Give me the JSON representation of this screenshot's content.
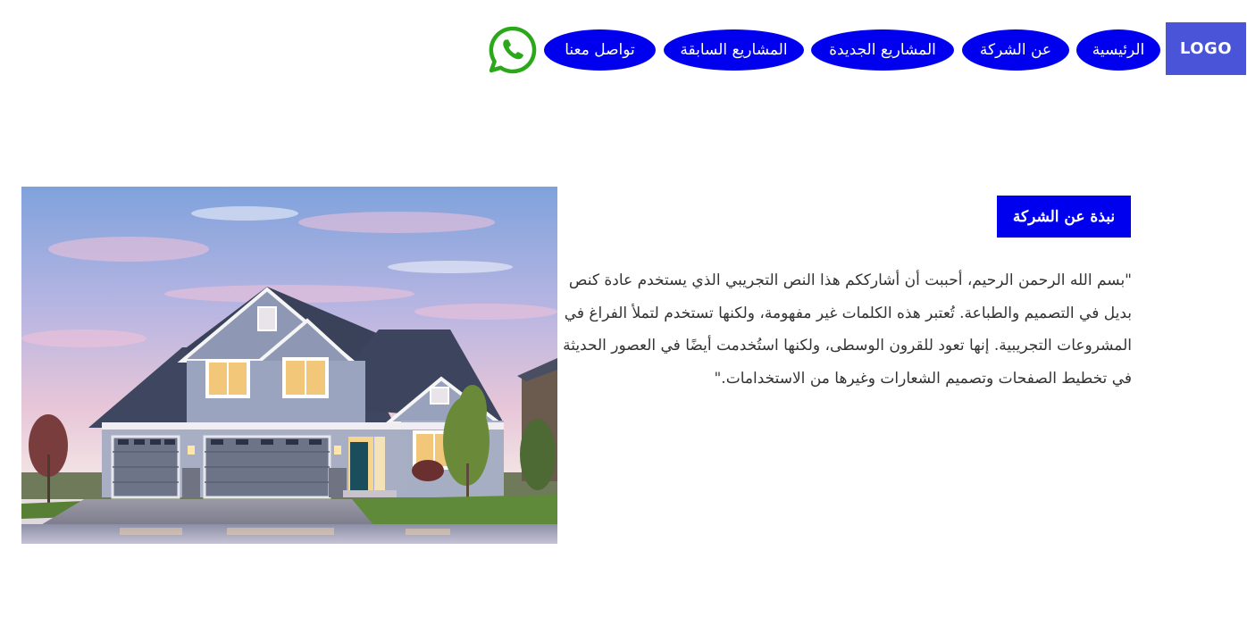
{
  "header": {
    "logo_text": "LOGO",
    "nav": {
      "home": "الرئيسية",
      "about": "عن الشركة",
      "new_projects": "المشاريع الجديدة",
      "previous_projects": "المشاريع السابقة",
      "contact": "تواصل معنا"
    },
    "whatsapp_icon": "whatsapp-icon"
  },
  "about": {
    "heading": "نبذة عن الشركة",
    "body": "\"بسم الله الرحمن الرحيم، أحببت أن أشارككم هذا النص التجريبي الذي يستخدم عادة كنص بديل في التصميم والطباعة. تُعتبر هذه الكلمات غير مفهومة، ولكنها تستخدم لتملأ الفراغ في المشروعات التجريبية. إنها تعود للقرون الوسطى، ولكنها استُخدمت أيضًا في العصور الحديثة في تخطيط الصفحات وتصميم الشعارات وغيرها من الاستخدامات.\""
  },
  "colors": {
    "nav_blue": "#0000ee",
    "logo_bg": "#4a54d8",
    "whatsapp_green": "#2aa81a",
    "text": "#333333"
  }
}
